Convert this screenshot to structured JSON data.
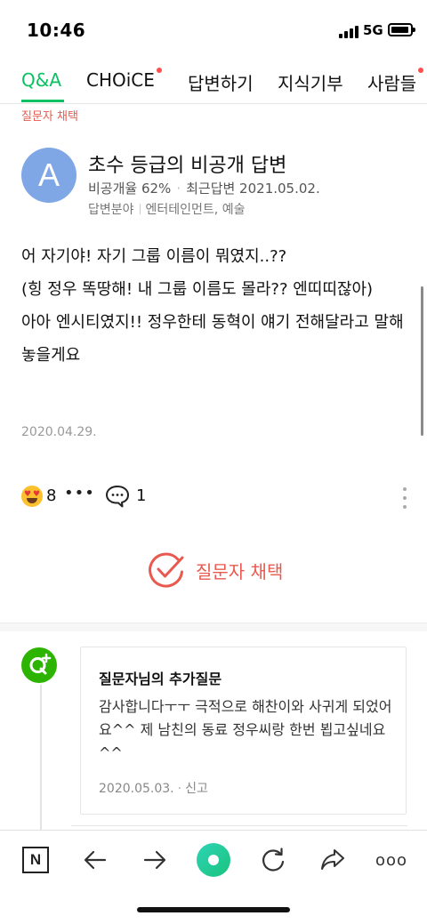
{
  "status_bar": {
    "time": "10:46",
    "network": "5G"
  },
  "tabs": [
    {
      "label": "Q&A",
      "active": true,
      "has_dot": false
    },
    {
      "label": "CHOiCE",
      "active": false,
      "has_dot": true
    },
    {
      "label": "답변하기",
      "active": false,
      "has_dot": false
    },
    {
      "label": "지식기부",
      "active": false,
      "has_dot": false
    },
    {
      "label": "사람들",
      "active": false,
      "has_dot": true
    }
  ],
  "selected_label": "질문자 채택",
  "answer": {
    "avatar_letter": "A",
    "answerer": "초수 등급의 비공개 답변",
    "private_rate": "비공개율 62%",
    "meta_sep": "·",
    "last_answer": "최근답변 2021.05.02.",
    "field_label": "답변분야",
    "field_value": "엔터테인먼트, 예술",
    "body": [
      "어 자기야! 자기 그룹 이름이 뭐였지..??",
      "(힝 정우 똑땅해! 내 그룹 이름도 몰라?? 엔띠띠잖아)",
      "아아 엔시티였지!! 정우한테 동혁이 얘기 전해달라고 말해놓을게요"
    ],
    "date": "2020.04.29.",
    "like_count": "8",
    "more_reactions": "•••",
    "comment_count": "1"
  },
  "select_button": {
    "label": "질문자 채택"
  },
  "additional_question": {
    "title": "질문자님의 추가질문",
    "body": "감사합니다ㅜㅜ 극적으로 해찬이와 사귀게 되었어요^^ 제 남친의 동료 정우씨랑 한번 뵙고싶네요^^",
    "date": "2020.05.03.",
    "sep": "·",
    "report": "신고"
  },
  "bottom_nav": {
    "n_label": "N",
    "more": "ooo"
  },
  "colors": {
    "accent_green": "#0ac262",
    "select_red": "#e85a4f",
    "avatar_blue": "#7fa7e6",
    "q_badge_green": "#2db400"
  },
  "icons": [
    "back-arrow-icon",
    "forward-arrow-icon",
    "refresh-icon",
    "share-icon",
    "more-icon",
    "comment-icon",
    "heart-eyes-emoji-icon",
    "check-circle-icon",
    "question-plus-icon"
  ]
}
